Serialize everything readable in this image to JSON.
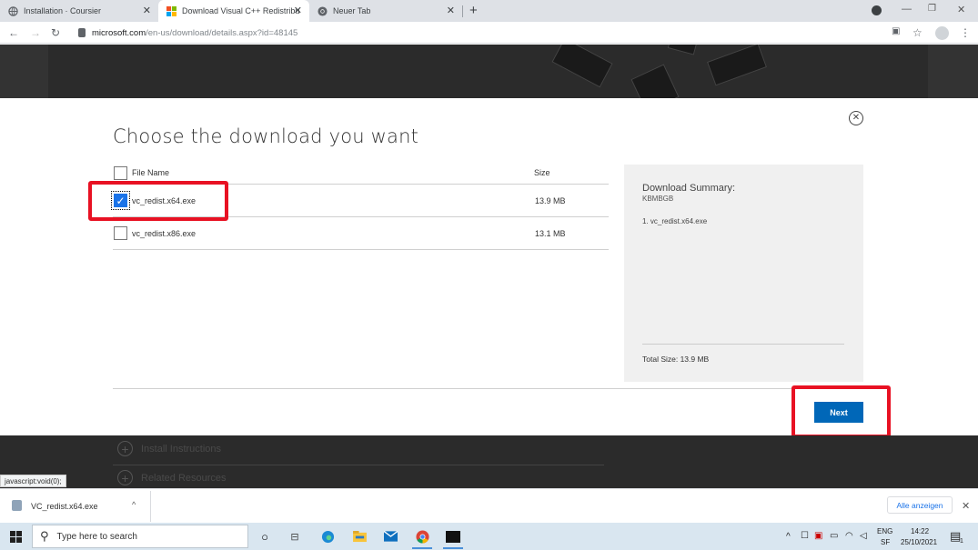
{
  "browser": {
    "tabs": [
      {
        "title": "Installation · Coursier",
        "active": false
      },
      {
        "title": "Download Visual C++ Redistribu",
        "active": true
      },
      {
        "title": "Neuer Tab",
        "active": false
      }
    ],
    "new_tab_glyph": "+",
    "url_host": "microsoft.com",
    "url_path": "/en-us/download/details.aspx?id=48145"
  },
  "dialog": {
    "title": "Choose the download you want",
    "col_filename": "File Name",
    "col_size": "Size",
    "files": [
      {
        "name": "vc_redist.x64.exe",
        "size": "13.9 MB",
        "checked": true
      },
      {
        "name": "vc_redist.x86.exe",
        "size": "13.1 MB",
        "checked": false
      }
    ],
    "summary_title": "Download Summary:",
    "summary_sub": "KBMBGB",
    "summary_item": "1. vc_redist.x64.exe",
    "total_size": "Total Size: 13.9 MB",
    "next_label": "Next"
  },
  "accordion": {
    "install_instructions": "Install Instructions",
    "related_resources": "Related Resources"
  },
  "status_link": "javascript:void(0);",
  "download_shelf": {
    "file_name": "VC_redist.x64.exe",
    "show_all": "Alle anzeigen"
  },
  "taskbar": {
    "search_placeholder": "Type here to search",
    "lang_top": "ENG",
    "lang_bottom": "SF",
    "time": "14:22",
    "date": "25/10/2021",
    "notification_count": "1"
  },
  "colors": {
    "accent_blue": "#0067b8",
    "highlight_red": "#e81123",
    "checkbox_blue": "#1a73e8",
    "dark_band": "#2b2b2b"
  }
}
